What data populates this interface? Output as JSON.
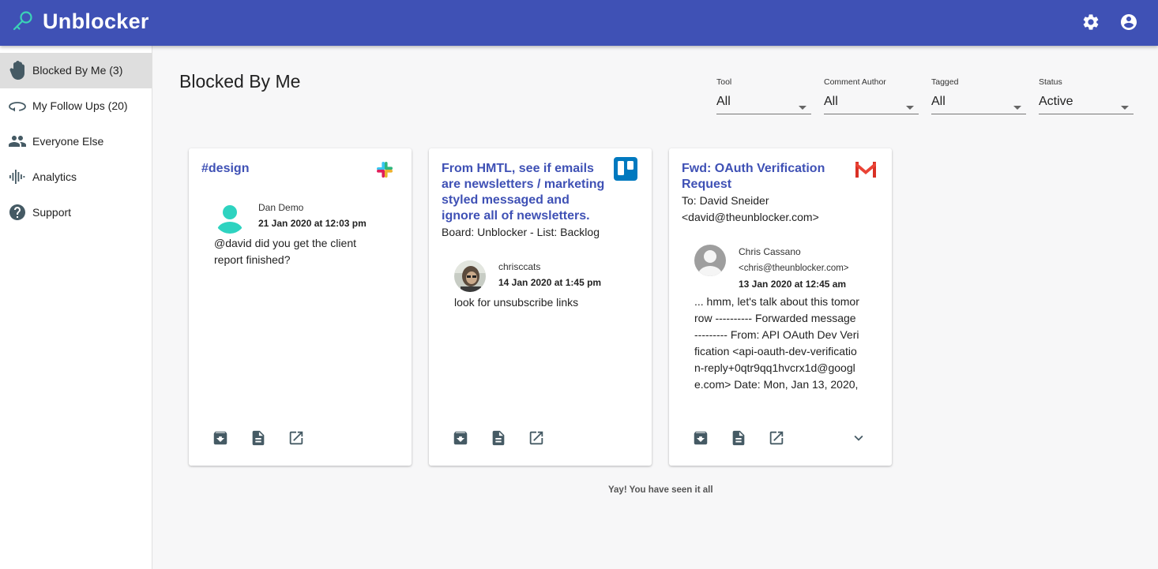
{
  "app": {
    "title": "Unblocker"
  },
  "header_icons": {
    "settings": "gear-icon",
    "account": "account-circle-icon"
  },
  "sidebar": {
    "items": [
      {
        "label": "Blocked By Me (3)",
        "icon": "hand-icon",
        "active": true
      },
      {
        "label": "My Follow Ups (20)",
        "icon": "follow-up-icon",
        "active": false
      },
      {
        "label": "Everyone Else",
        "icon": "people-icon",
        "active": false
      },
      {
        "label": "Analytics",
        "icon": "analytics-icon",
        "active": false
      },
      {
        "label": "Support",
        "icon": "help-icon",
        "active": false
      }
    ]
  },
  "main": {
    "title": "Blocked By Me",
    "filters": [
      {
        "label": "Tool",
        "value": "All"
      },
      {
        "label": "Comment Author",
        "value": "All"
      },
      {
        "label": "Tagged",
        "value": "All"
      },
      {
        "label": "Status",
        "value": "Active"
      }
    ],
    "cards": [
      {
        "title": "#design",
        "source": "slack",
        "author": "Dan Demo",
        "date": "21 Jan 2020 at 12:03 pm",
        "comment": "@david did you get the client report finished?"
      },
      {
        "title": "From HMTL, see if emails are newsletters / marketing styled messaged and ignore all of newsletters.",
        "subtitle": "Board: Unblocker - List: Backlog",
        "source": "trello",
        "author": "chrisccats",
        "date": "14 Jan 2020 at 1:45 pm",
        "comment": "look for unsubscribe links"
      },
      {
        "title": "Fwd: OAuth Verification Request",
        "subtitle_line1": "To: David Sneider",
        "subtitle_line2": "<david@theunblocker.com>",
        "source": "gmail",
        "author": "Chris Cassano",
        "author_email": "<chris@theunblocker.com>",
        "date": "13 Jan 2020 at 12:45 am",
        "comment": "... hmm, let's talk about this tomorrow ---------- Forwarded message --------- From: API OAuth Dev Verification <api-oauth-dev-verification-reply+0qtr9qq1hvcrx1d@google.com> Date: Mon, Jan 13, 2020,"
      }
    ],
    "end_message": "Yay! You have seen it all"
  },
  "colors": {
    "primary": "#3f51b5",
    "avatar_teal": "#2ed3c0",
    "trello_blue": "#0079bf",
    "gmail_red": "#d93025",
    "icon_gray": "#455a64"
  }
}
